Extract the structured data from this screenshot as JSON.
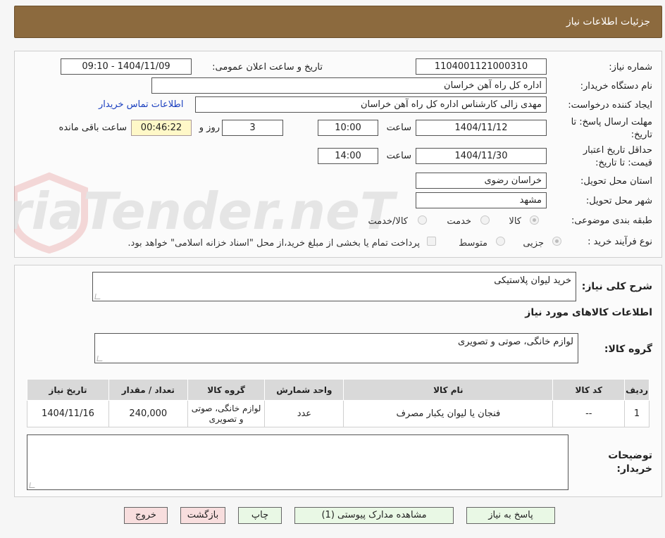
{
  "header": {
    "title": "جزئیات اطلاعات نیاز"
  },
  "watermark": {
    "text": "AriaTender.neT"
  },
  "form": {
    "need_number_label": "شماره نیاز:",
    "need_number": "1104001121000310",
    "announce_label": "تاریخ و ساعت اعلان عمومی:",
    "announce_value": "1404/11/09 - 09:10",
    "buyer_label": "نام دستگاه خریدار:",
    "buyer_value": "اداره کل راه آهن خراسان",
    "creator_label": "ایجاد کننده درخواست:",
    "creator_value": "مهدی زالی کارشناس اداره کل راه آهن خراسان",
    "contact_link": "اطلاعات تماس خریدار",
    "deadline_label_1": "مهلت ارسال پاسخ: تا",
    "deadline_label_2": "تاریخ:",
    "deadline_date": "1404/11/12",
    "time_label": "ساعت",
    "deadline_time": "10:00",
    "days_value": "3",
    "days_label": "روز و",
    "remaining_time": "00:46:22",
    "remaining_label": "ساعت باقی مانده",
    "validity_label_1": "حداقل تاریخ اعتبار",
    "validity_label_2": "قیمت: تا تاریخ:",
    "validity_date": "1404/11/30",
    "validity_time": "14:00",
    "province_label": "استان محل تحویل:",
    "province_value": "خراسان رضوی",
    "city_label": "شهر محل تحویل:",
    "city_value": "مشهد",
    "category_label": "طبقه بندی موضوعی:",
    "category_options": [
      "کالا",
      "خدمت",
      "کالا/خدمت"
    ],
    "process_label": "نوع فرآیند خرید :",
    "process_options": [
      "جزیی",
      "متوسط"
    ],
    "payment_note": "پرداخت تمام یا بخشی از مبلغ خرید،از محل \"اسناد خزانه اسلامی\" خواهد بود."
  },
  "details": {
    "summary_label": "شرح کلی نیاز:",
    "summary_value": "خرید لیوان پلاستیکی",
    "items_heading": "اطلاعات کالاهای مورد نیاز",
    "group_label": "گروه کالا:",
    "group_value": "لوازم خانگی، صوتی و تصویری",
    "table": {
      "headers": [
        "ردیف",
        "کد کالا",
        "نام کالا",
        "واحد شمارش",
        "گروه کالا",
        "تعداد / مقدار",
        "تاریخ نیاز"
      ],
      "rows": [
        [
          "1",
          "--",
          "فنجان یا لیوان یکبار مصرف",
          "عدد",
          "لوازم خانگی، صوتی و تصویری",
          "240,000",
          "1404/11/16"
        ]
      ]
    },
    "buyer_notes_label_1": "توضیحات",
    "buyer_notes_label_2": "خریدار:"
  },
  "buttons": {
    "reply": "پاسخ به نیاز",
    "attachments": "مشاهده مدارک پیوستی (1)",
    "print": "چاپ",
    "back": "بازگشت",
    "exit": "خروج"
  }
}
